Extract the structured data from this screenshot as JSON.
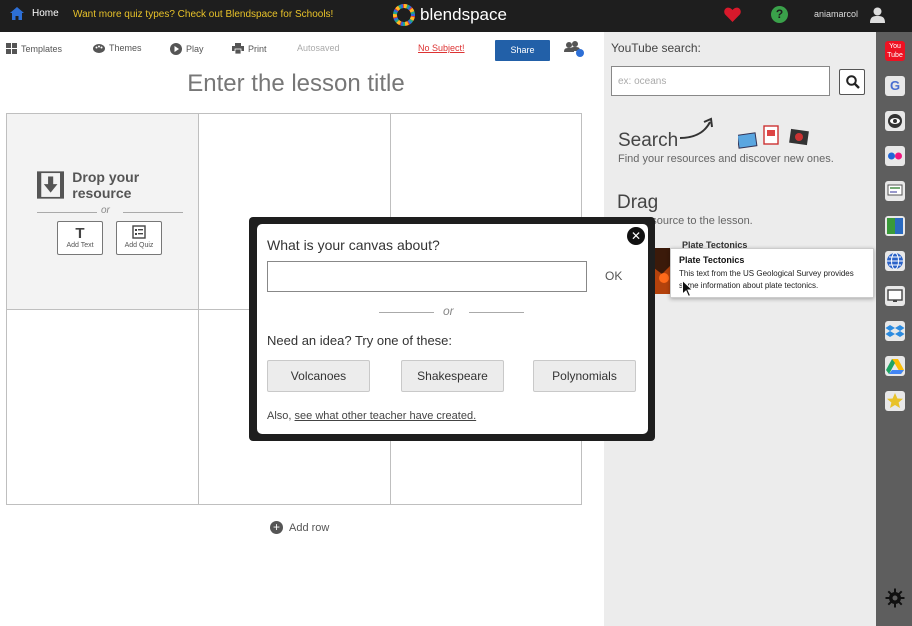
{
  "topbar": {
    "home_label": "Home",
    "promo_text": "Want more quiz types? Check out Blendspace for Schools!",
    "logo_text": "blendspace",
    "help_glyph": "?",
    "username": "aniamarcol"
  },
  "toolbar": {
    "templates_label": "Templates",
    "themes_label": "Themes",
    "play_label": "Play",
    "print_label": "Print",
    "autosaved_label": "Autosaved",
    "no_subject_label": "No Subject!",
    "share_label": "Share",
    "collab_count": "1"
  },
  "lesson": {
    "title_placeholder": "Enter the lesson title",
    "drop_text": "Drop your resource",
    "or_text": "or",
    "add_text_label": "Add Text",
    "add_quiz_label": "Add Quiz",
    "add_row_label": "Add row"
  },
  "right_panel": {
    "youtube_label": "YouTube search:",
    "youtube_placeholder": "ex: oceans",
    "search_heading": "Search",
    "search_sub": "Find your resources and discover new ones.",
    "drag_heading": "Drag",
    "drag_sub": "your resource to the lesson.",
    "resource_title": "Plate Tectonics",
    "tooltip_title": "Plate Tectonics",
    "tooltip_body": "This text from the US Geological Survey provides some information about plate tectonics."
  },
  "rail": {
    "icons": [
      "youtube-icon",
      "google-icon",
      "educreations-icon",
      "flickr-icon",
      "slides-icon",
      "gooru-icon",
      "web-icon",
      "screen-icon",
      "dropbox-icon",
      "google-drive-icon",
      "favorites-icon",
      "settings-icon"
    ]
  },
  "modal": {
    "question": "What is your canvas about?",
    "ok_label": "OK",
    "or_text": "or",
    "idea_text": "Need an idea? Try one of these:",
    "suggestions": [
      "Volcanoes",
      "Shakespeare",
      "Polynomials"
    ],
    "also_prefix": "Also,",
    "also_link": "see what other teacher have created."
  },
  "colors": {
    "topbar_bg": "#1e1e1e",
    "promo": "#e8c229",
    "share_button": "#2260a8",
    "no_subject": "#dd3333",
    "help": "#3aa14a",
    "heart": "#d8192b",
    "panel_bg": "#ececec",
    "rail_bg": "#5e5e5e"
  }
}
